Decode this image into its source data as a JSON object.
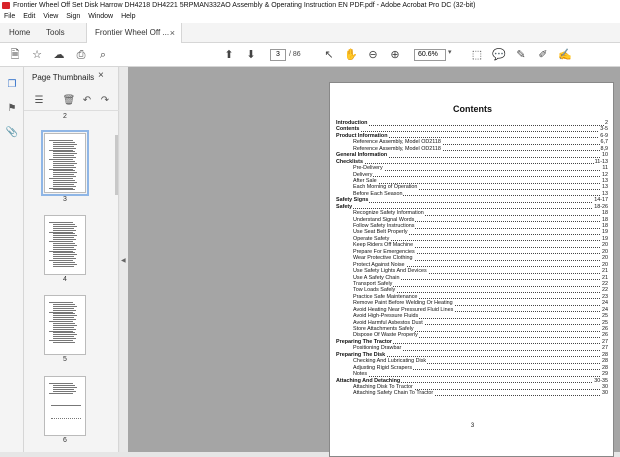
{
  "window": {
    "title": "Frontier Wheel Off Set Disk Harrow DH4218 DH4221 5RPMAN332AO Assembly & Operating Instruction EN PDF.pdf - Adobe Acrobat Pro DC (32-bit)"
  },
  "menu": [
    "File",
    "Edit",
    "View",
    "Sign",
    "Window",
    "Help"
  ],
  "tabs": {
    "home": "Home",
    "tools": "Tools",
    "document": "Frontier Wheel Off ...",
    "close": "×"
  },
  "toolbar": {
    "current_page": "3",
    "total_pages": "/  86",
    "zoom": "60.6%"
  },
  "panel": {
    "title": "Page Thumbnails",
    "close": "×"
  },
  "thumbnails": [
    {
      "label": "2"
    },
    {
      "label": "3",
      "selected": true
    },
    {
      "label": "4"
    },
    {
      "label": "5"
    },
    {
      "label": "6"
    }
  ],
  "document": {
    "heading": "Contents",
    "page_number": "3",
    "toc": [
      {
        "text": "Introduction",
        "page": "2",
        "level": 0
      },
      {
        "text": "Contents",
        "page": "3-5",
        "level": 0
      },
      {
        "text": "Product Information",
        "page": "6-9",
        "level": 0
      },
      {
        "text": "Reference Assembly, Model OD2118",
        "page": "6,7",
        "level": 1
      },
      {
        "text": "Reference Assembly, Model OD2118",
        "page": "8,9",
        "level": 1
      },
      {
        "text": "General Information",
        "page": "10",
        "level": 0
      },
      {
        "text": "Checklists",
        "page": "11-13",
        "level": 0
      },
      {
        "text": "Pre-Delivery",
        "page": "11",
        "level": 1
      },
      {
        "text": "Delivery",
        "page": "12",
        "level": 1
      },
      {
        "text": "After Sale",
        "page": "13",
        "level": 1
      },
      {
        "text": "Each Morning of Operation",
        "page": "13",
        "level": 1
      },
      {
        "text": "Before Each Season",
        "page": "13",
        "level": 1
      },
      {
        "text": "Safety Signs",
        "page": "14-17",
        "level": 0
      },
      {
        "text": "Safety",
        "page": "18-26",
        "level": 0
      },
      {
        "text": "Recognize Safety Information",
        "page": "18",
        "level": 1
      },
      {
        "text": "Understand Signal Words",
        "page": "18",
        "level": 1
      },
      {
        "text": "Follow Safety Instructions",
        "page": "18",
        "level": 1
      },
      {
        "text": "Use Seat Belt Properly",
        "page": "19",
        "level": 1
      },
      {
        "text": "Operate Safety",
        "page": "19",
        "level": 1
      },
      {
        "text": "Keep Riders Off Machine",
        "page": "20",
        "level": 1
      },
      {
        "text": "Prepare For Emergencies",
        "page": "20",
        "level": 1
      },
      {
        "text": "Wear Protective Clothing",
        "page": "20",
        "level": 1
      },
      {
        "text": "Protect Against Noise",
        "page": "20",
        "level": 1
      },
      {
        "text": "Use Safety Lights And Devices",
        "page": "21",
        "level": 1
      },
      {
        "text": "Use A Safety Chain",
        "page": "21",
        "level": 1
      },
      {
        "text": "Transport Safely",
        "page": "22",
        "level": 1
      },
      {
        "text": "Tow Loads Safely",
        "page": "22",
        "level": 1
      },
      {
        "text": "Practice Safe Maintenance",
        "page": "23",
        "level": 1
      },
      {
        "text": "Remove Paint Before Welding Or Heating",
        "page": "24",
        "level": 1
      },
      {
        "text": "Avoid Heating Near Pressured Fluid Lines",
        "page": "24",
        "level": 1
      },
      {
        "text": "Avoid High-Pressure Fluids",
        "page": "25",
        "level": 1
      },
      {
        "text": "Avoid Harmful Asbestos Dust",
        "page": "25",
        "level": 1
      },
      {
        "text": "Store Attachments Safely",
        "page": "26",
        "level": 1
      },
      {
        "text": "Dispose Of Waste Properly",
        "page": "26",
        "level": 1
      },
      {
        "text": "Preparing The Tractor",
        "page": "27",
        "level": 0
      },
      {
        "text": "Positioning Drawbar",
        "page": "27",
        "level": 1
      },
      {
        "text": "Preparing The Disk",
        "page": "28",
        "level": 0
      },
      {
        "text": "Checking And Lubricating Disk",
        "page": "28",
        "level": 1
      },
      {
        "text": "Adjusting Rigid Scrapers",
        "page": "28",
        "level": 1
      },
      {
        "text": "Notes",
        "page": "29",
        "level": 1
      },
      {
        "text": "Attaching And Detaching",
        "page": "30-35",
        "level": 0
      },
      {
        "text": "Attaching Disk To Tractor",
        "page": "30",
        "level": 1
      },
      {
        "text": "Attaching Safety Chain To Tractor",
        "page": "30",
        "level": 1
      }
    ]
  },
  "colors": {
    "app_red": "#d8232a",
    "page_bg": "#a5a5a5",
    "selection": "#8fb6e6"
  }
}
